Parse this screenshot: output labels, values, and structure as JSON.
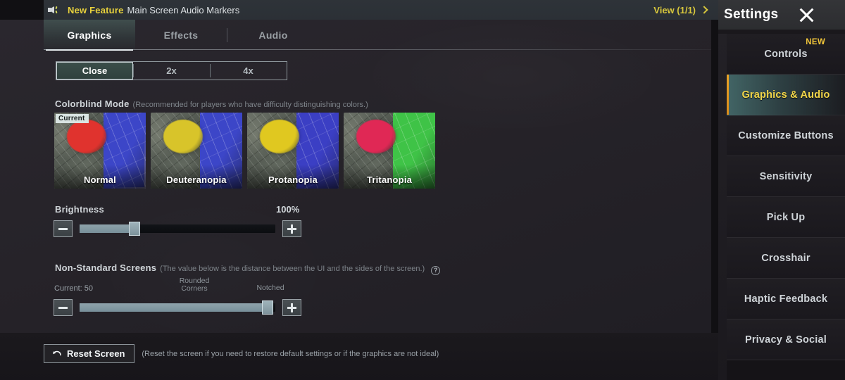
{
  "banner": {
    "icon": "speaker-icon",
    "new_tag": "New Feature",
    "text": "Main Screen Audio Markers",
    "view_label": "View (1/1)",
    "chevron": "chevron-right-icon"
  },
  "tabs": [
    {
      "label": "Graphics",
      "active": true
    },
    {
      "label": "Effects",
      "active": false
    },
    {
      "label": "Audio",
      "active": false
    }
  ],
  "segmented": {
    "options": [
      {
        "label": "Close",
        "active": true
      },
      {
        "label": "2x",
        "active": false
      },
      {
        "label": "4x",
        "active": false
      }
    ]
  },
  "colorblind": {
    "title": "Colorblind Mode",
    "description": "(Recommended for players who have difficulty distinguishing colors.)",
    "current_tag": "Current",
    "options": [
      {
        "label": "Normal",
        "selected": true,
        "blob_color": "#e0332e",
        "water_color": "#3c46c8"
      },
      {
        "label": "Deuteranopia",
        "selected": false,
        "blob_color": "#d8c42a",
        "water_color": "#3c46c8"
      },
      {
        "label": "Protanopia",
        "selected": false,
        "blob_color": "#e0c820",
        "water_color": "#3b3fc4"
      },
      {
        "label": "Tritanopia",
        "selected": false,
        "blob_color": "#e02855",
        "water_color": "#3fc347"
      }
    ]
  },
  "brightness": {
    "label": "Brightness",
    "value_label": "100%",
    "fill_percent": 28,
    "minus": "minus-icon",
    "plus": "plus-icon"
  },
  "non_standard": {
    "title": "Non-Standard Screens",
    "description": "(The value below is the distance between the UI and the sides of the screen.)",
    "help": "?",
    "current_label": "Current: 50",
    "left_mark": "Rounded\nCorners",
    "right_mark": "Notched",
    "fill_percent": 96,
    "minus": "minus-icon",
    "plus": "plus-icon"
  },
  "reset": {
    "label": "Reset Screen",
    "icon": "undo-arrow-icon",
    "description": "(Reset the screen if you need to restore default settings or if the graphics are not ideal)"
  },
  "sidebar": {
    "title": "Settings",
    "close_icon": "close-icon",
    "items": [
      {
        "label": "Controls",
        "active": false,
        "badge": "NEW"
      },
      {
        "label": "Graphics & Audio",
        "active": true,
        "badge": ""
      },
      {
        "label": "Customize Buttons",
        "active": false,
        "badge": ""
      },
      {
        "label": "Sensitivity",
        "active": false,
        "badge": ""
      },
      {
        "label": "Pick Up",
        "active": false,
        "badge": ""
      },
      {
        "label": "Crosshair",
        "active": false,
        "badge": ""
      },
      {
        "label": "Haptic Feedback",
        "active": false,
        "badge": ""
      },
      {
        "label": "Privacy & Social",
        "active": false,
        "badge": ""
      }
    ]
  },
  "colors": {
    "accent_yellow": "#e8d13c",
    "accent_gold": "#f2d64a",
    "teal_highlight": "#5c9694",
    "orange_bar": "#e8a326",
    "panel_bg": "#2a272e"
  }
}
